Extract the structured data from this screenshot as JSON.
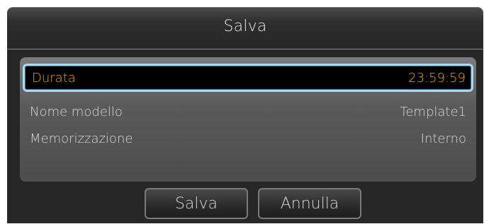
{
  "dialog": {
    "title": "Salva",
    "rows": [
      {
        "label": "Durata",
        "value": "23:59:59"
      },
      {
        "label": "Nome modello",
        "value": "Template1"
      },
      {
        "label": "Memorizzazione",
        "value": "Interno"
      }
    ],
    "buttons": {
      "save_label": "Salva",
      "cancel_label": "Annulla"
    }
  },
  "colors": {
    "selected_text": "#f0a400",
    "selection_border": "#a9d8f2"
  }
}
